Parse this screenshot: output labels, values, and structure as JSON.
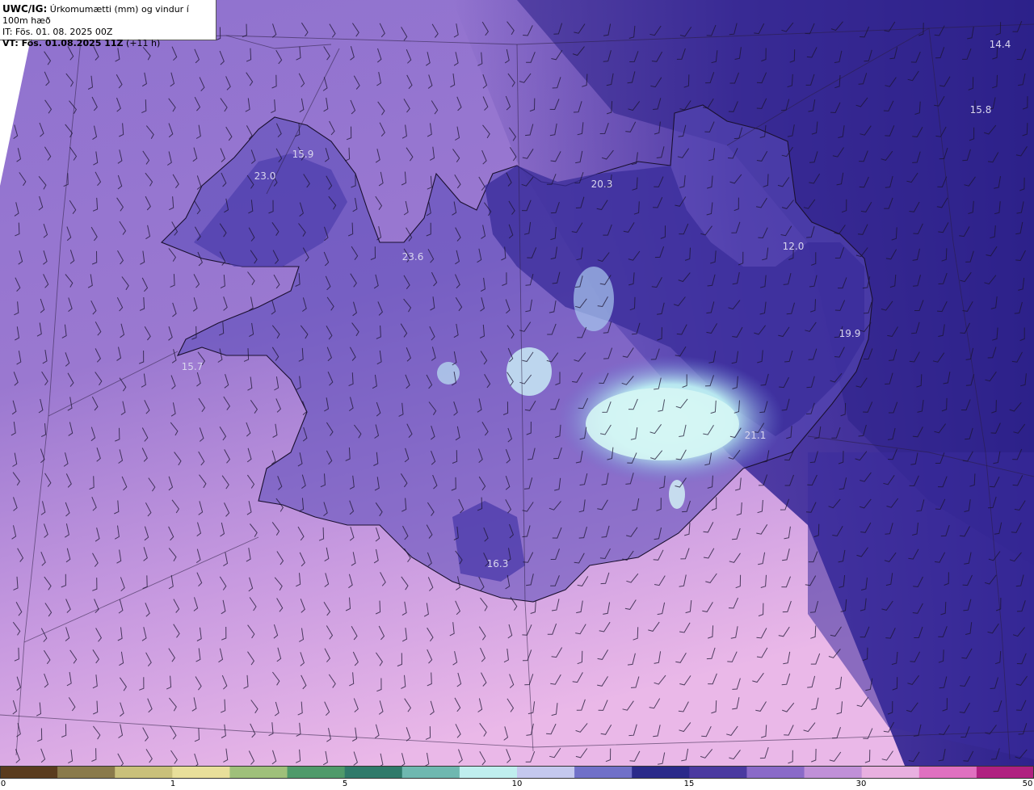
{
  "header": {
    "model": "UWC/IG:",
    "title": " Úrkomumætti (mm) og vindur í 100m hæð",
    "initial_time": "IT: Fös. 01. 08. 2025 00Z",
    "valid_time": "VT: Fös. 01.08.2025 11Z",
    "lead_time": " (+11 h)"
  },
  "map_labels": [
    {
      "text": "14.4"
    },
    {
      "text": "15.8"
    },
    {
      "text": "15.9"
    },
    {
      "text": "23.0"
    },
    {
      "text": "20.3"
    },
    {
      "text": "12.0"
    },
    {
      "text": "23.6"
    },
    {
      "text": "19.9"
    },
    {
      "text": "15.7"
    },
    {
      "text": "21.1"
    },
    {
      "text": "16.3"
    }
  ],
  "colorbar": {
    "ticks": [
      "0",
      "1",
      "5",
      "10",
      "15",
      "30",
      "50"
    ],
    "colors": [
      "#5a3c1e",
      "#8a7a4a",
      "#c9c07a",
      "#e8df9a",
      "#9fc07a",
      "#4f9a6a",
      "#2f7a6a",
      "#6fb8b0",
      "#bfeeee",
      "#c4c8ee",
      "#7070c8",
      "#2a2a8a",
      "#4a3aa0",
      "#8a6ac8",
      "#c090d8",
      "#e8b0e0",
      "#e070c0",
      "#b02080"
    ]
  }
}
